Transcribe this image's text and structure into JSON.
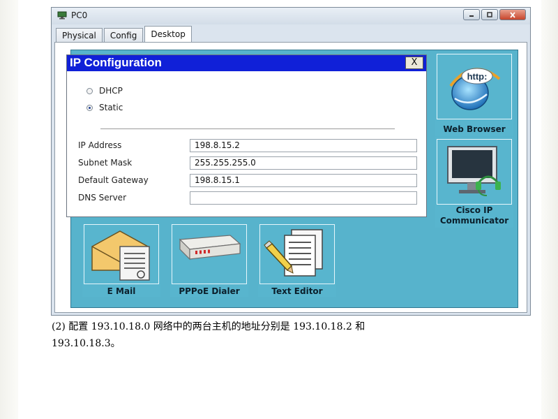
{
  "window": {
    "title": "PC0",
    "controls": [
      "minimize",
      "maximize",
      "close"
    ],
    "tabs": [
      {
        "label": "Physical",
        "active": false
      },
      {
        "label": "Config",
        "active": false
      },
      {
        "label": "Desktop",
        "active": true
      }
    ]
  },
  "desktop": {
    "background_color": "#57b3cc",
    "apps": [
      {
        "label": "Web Browser",
        "icon": "web-browser-icon"
      },
      {
        "label": "Cisco IP Communicator",
        "icon": "ip-communicator-icon"
      },
      {
        "label": "E Mail",
        "icon": "email-icon"
      },
      {
        "label": "PPPoE Dialer",
        "icon": "pppoe-dialer-icon"
      },
      {
        "label": "Text Editor",
        "icon": "text-editor-icon"
      }
    ],
    "browser_icon_text": "http:"
  },
  "ip_config": {
    "title": "IP Configuration",
    "close_label": "X",
    "modes": [
      {
        "label": "DHCP",
        "selected": false
      },
      {
        "label": "Static",
        "selected": true
      }
    ],
    "fields": [
      {
        "label": "IP Address",
        "value": "198.8.15.2"
      },
      {
        "label": "Subnet Mask",
        "value": "255.255.255.0"
      },
      {
        "label": "Default Gateway",
        "value": "198.8.15.1"
      },
      {
        "label": "DNS Server",
        "value": ""
      }
    ],
    "title_bar_color": "#1020d8"
  },
  "caption": {
    "line1": "(2) 配置 193.10.18.0 网络中的两台主机的地址分别是 193.10.18.2 和",
    "line2": "193.10.18.3。"
  }
}
